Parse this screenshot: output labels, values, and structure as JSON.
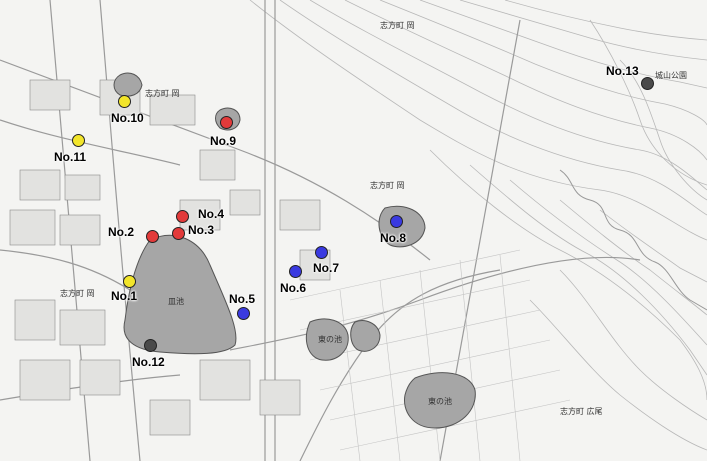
{
  "colors": {
    "yellow": "#f2e52a",
    "red": "#e23a3a",
    "blue": "#3a3ae0",
    "black": "#4a4a4a"
  },
  "map_labels": {
    "shikata_oka_top": "志方町 岡",
    "shikata_oka_mid": "志方町 岡",
    "shikata_oka_left": "志方町 岡",
    "shikata_oka_upper": "志方町 岡",
    "shikata_hiroo": "志方町 広尾",
    "pond_center": "皿池",
    "pond_east": "東の池",
    "pond_southeast": "東の池",
    "castle_park": "城山公園"
  },
  "markers": [
    {
      "id": "no1",
      "label": "No.1",
      "color": "yellow"
    },
    {
      "id": "no2",
      "label": "No.2",
      "color": "red"
    },
    {
      "id": "no3",
      "label": "No.3",
      "color": "red"
    },
    {
      "id": "no4",
      "label": "No.4",
      "color": "red"
    },
    {
      "id": "no5",
      "label": "No.5",
      "color": "blue"
    },
    {
      "id": "no6",
      "label": "No.6",
      "color": "blue"
    },
    {
      "id": "no7",
      "label": "No.7",
      "color": "blue"
    },
    {
      "id": "no8",
      "label": "No.8",
      "color": "blue"
    },
    {
      "id": "no9",
      "label": "No.9",
      "color": "red"
    },
    {
      "id": "no10",
      "label": "No.10",
      "color": "yellow"
    },
    {
      "id": "no11",
      "label": "No.11",
      "color": "yellow"
    },
    {
      "id": "no12",
      "label": "No.12",
      "color": "black"
    },
    {
      "id": "no13",
      "label": "No.13",
      "color": "black"
    }
  ]
}
